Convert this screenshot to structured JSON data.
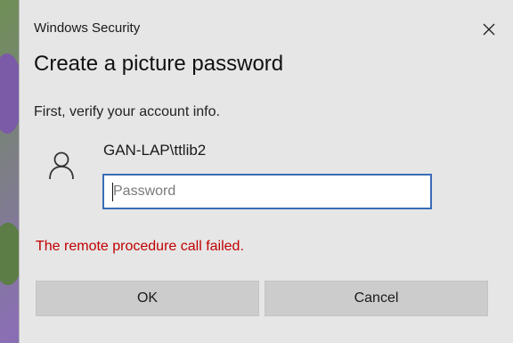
{
  "window": {
    "title": "Windows Security",
    "close_icon": "close-icon"
  },
  "dialog": {
    "heading": "Create a picture password",
    "subtext": "First, verify your account info.",
    "account": {
      "avatar_icon": "user-icon",
      "username": "GAN-LAP\\ttlib2"
    },
    "password": {
      "placeholder": "Password",
      "value": ""
    },
    "error": "The remote procedure call failed.",
    "buttons": {
      "ok_label": "OK",
      "cancel_label": "Cancel"
    }
  },
  "colors": {
    "error": "#c00000",
    "focus_border": "#3a6cb5",
    "dialog_bg": "#e6e6e6",
    "button_bg": "#cccccc"
  }
}
